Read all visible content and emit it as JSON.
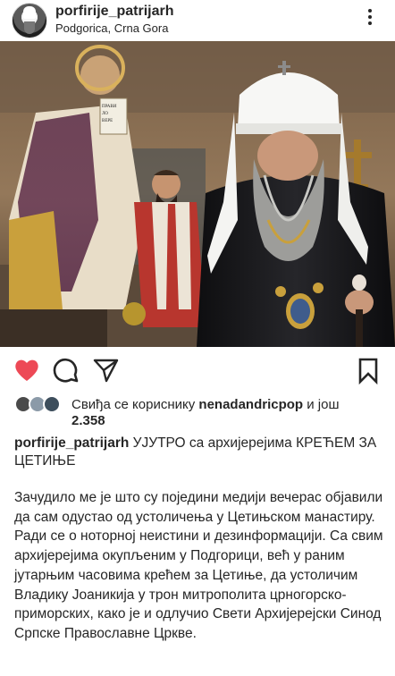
{
  "post": {
    "username": "porfirije_patrijarh",
    "location": "Podgorica, Crna Gora"
  },
  "photo": {
    "icon_inscription": "ПРАВИ ЛО ВЕРЕ"
  },
  "likes": {
    "prefix": "Свиђа се кориснику ",
    "user": "nenadandricpop",
    "suffix": " и још",
    "count": "2.358"
  },
  "caption": {
    "username": "porfirije_patrijarh",
    "headline": " УЈУТРО са архијерејима КРЕЋЕМ ЗА ЦЕТИЊЕ",
    "body": "Зачудило ме је што су поједини медији вечерас објавили да сам одустао од устоличења у Цетињском манастиру. Ради се о ноторној неистини и дезинформацији. Са свим архијерејима окупљеним у Подгорици, већ у раним јутарњим часовима крећем за Цетиње, да устоличим Владику Јоаникија у трон митрополита црногорско-приморских, како је и одлучио Свети Архијерејски Синод Српске Православне Цркве."
  },
  "colors": {
    "heart": "#ed4956",
    "text": "#262626"
  },
  "icons": [
    "more-options-icon",
    "heart-icon",
    "comment-icon",
    "share-icon",
    "bookmark-icon"
  ]
}
